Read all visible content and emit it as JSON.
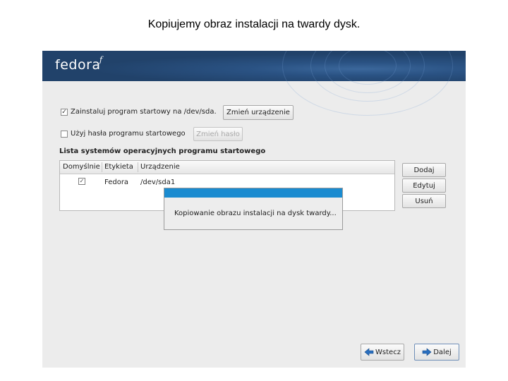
{
  "slide": {
    "title": "Kopiujemy obraz instalacji na twardy dysk."
  },
  "header": {
    "logo_text": "fedora",
    "logo_mark": "f"
  },
  "bootloader": {
    "install_checked": true,
    "install_check_glyph": "✓",
    "install_label": "Zainstaluj program startowy na /dev/sda.",
    "change_device_label": "Zmień urządzenie",
    "password_checked": false,
    "password_label": "Użyj hasła programu startowego",
    "change_password_label": "Zmień hasło"
  },
  "os_list": {
    "title": "Lista systemów operacyjnych programu startowego",
    "columns": [
      "Domyślnie",
      "Etykieta",
      "Urządzenie"
    ],
    "rows": [
      {
        "default_glyph": "✓",
        "label": "Fedora",
        "device": "/dev/sda1"
      }
    ],
    "add_label": "Dodaj",
    "edit_label": "Edytuj",
    "delete_label": "Usuń"
  },
  "progress_dialog": {
    "message": "Kopiowanie obrazu instalacji na dysk twardy..."
  },
  "nav": {
    "back_label": "Wstecz",
    "next_label": "Dalej"
  },
  "colors": {
    "banner": "#21426a",
    "dialog_titlebar": "#1a8bd0",
    "window_bg": "#ececec",
    "arrow_blue": "#2a6fbf"
  }
}
